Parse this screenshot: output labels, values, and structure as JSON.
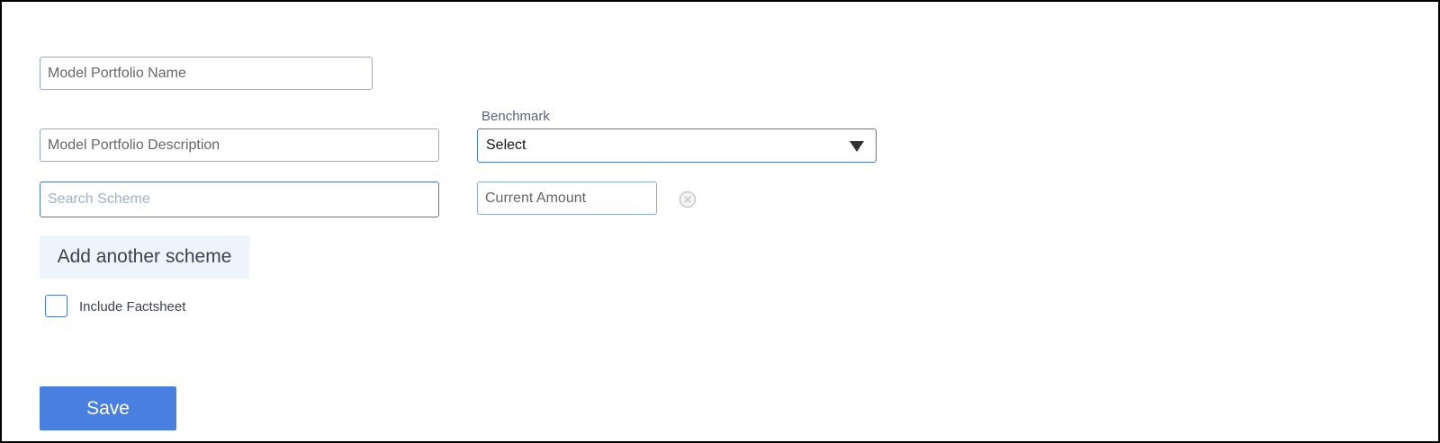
{
  "form": {
    "name_placeholder": "Model Portfolio Name",
    "description_placeholder": "Model Portfolio Description",
    "benchmark_label": "Benchmark",
    "benchmark_selected": "Select",
    "search_placeholder": "Search Scheme",
    "amount_placeholder": "Current Amount",
    "add_scheme_label": "Add another scheme",
    "include_factsheet_label": "Include Factsheet",
    "include_factsheet_checked": false,
    "save_label": "Save"
  },
  "icons": {
    "remove": "close-circle-icon",
    "dropdown": "triangle-down-icon"
  },
  "colors": {
    "primary": "#4a7fe2",
    "field_border": "#8fa8ea",
    "focus_border": "#4a76e0",
    "secondary_button_bg": "#eef4fb"
  }
}
